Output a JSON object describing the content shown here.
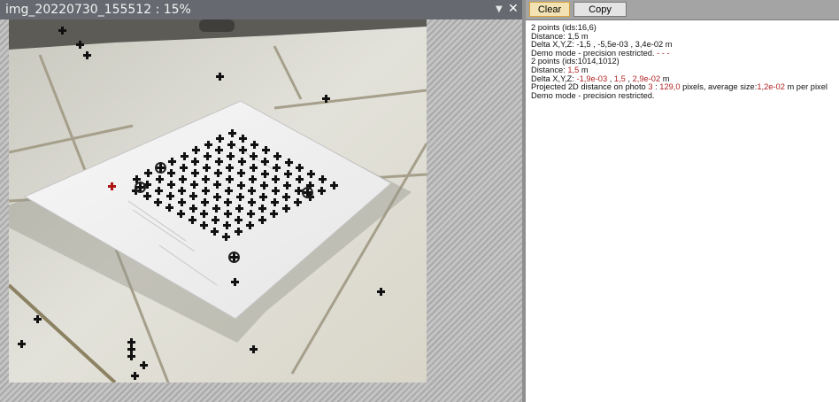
{
  "viewer": {
    "title": "img_20220730_155512 : 15%",
    "dropdown_icon": "▼",
    "close_icon": "✕"
  },
  "log_panel": {
    "clear_label": "Clear",
    "copy_label": "Copy",
    "highlight_color": "#b22222",
    "lines": [
      [
        {
          "t": "2 points (ids:16,6)"
        }
      ],
      [
        {
          "t": "Distance: 1,5 m"
        }
      ],
      [
        {
          "t": "Delta X,Y,Z: -1,5 , -5,5e-03 , 3,4e-02 m"
        }
      ],
      [
        {
          "t": "Demo mode - precision restricted."
        },
        {
          "t": " - - -",
          "h": true
        }
      ],
      [
        {
          "t": "2 points (ids:1014,1012)"
        }
      ],
      [
        {
          "t": "Distance: "
        },
        {
          "t": "1,5",
          "h": true
        },
        {
          "t": " m"
        }
      ],
      [
        {
          "t": "Delta X,Y,Z: "
        },
        {
          "t": "-1,9e-03",
          "h": true
        },
        {
          "t": " , "
        },
        {
          "t": "1,5",
          "h": true
        },
        {
          "t": " , "
        },
        {
          "t": "2,9e-02",
          "h": true
        },
        {
          "t": " m"
        }
      ],
      [
        {
          "t": "Projected 2D distance on photo "
        },
        {
          "t": "3",
          "h": true
        },
        {
          "t": " : "
        },
        {
          "t": "129,0",
          "h": true
        },
        {
          "t": " pixels, average size:"
        },
        {
          "t": "1,2e-02",
          "h": true
        },
        {
          "t": " m per pixel"
        }
      ],
      [
        {
          "t": "Demo mode - precision restricted."
        }
      ]
    ]
  }
}
